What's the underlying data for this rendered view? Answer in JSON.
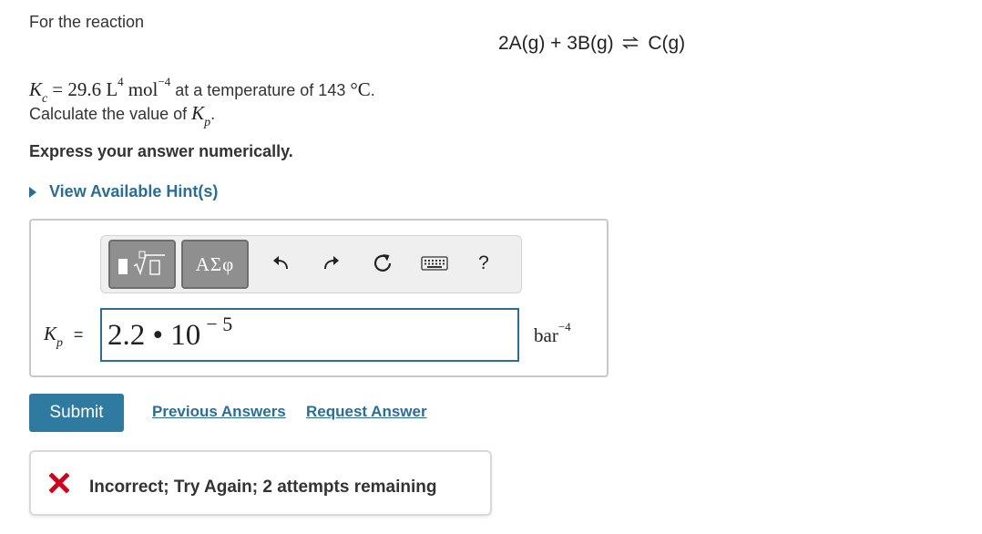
{
  "problem": {
    "intro": "For the reaction",
    "equation": {
      "left": "2A(g) + 3B(g)",
      "right": "C(g)"
    },
    "kc": {
      "symbol": "K",
      "subscript": "c",
      "value_text": "= 29.6 L",
      "l_exp": "4",
      "mol": "mol",
      "mol_exp": "−4",
      "temp_text": "at a temperature of 143",
      "temp_unit": "°C",
      "end": "."
    },
    "prompt_text": "Calculate the value of",
    "kp_symbol": "K",
    "kp_sub": "p",
    "prompt_end": ".",
    "instruction": "Express your answer numerically."
  },
  "hint": {
    "label": "View Available Hint(s)"
  },
  "toolbar": {
    "greek_label": "ΑΣφ",
    "help_label": "?",
    "icons": [
      "templates-icon",
      "greek-symbols-icon",
      "undo-icon",
      "redo-icon",
      "reset-icon",
      "keyboard-icon",
      "help-icon"
    ]
  },
  "answer": {
    "label_symbol": "K",
    "label_sub": "p",
    "label_eq": "=",
    "mantissa": "2.2 • 10",
    "exponent": "− 5",
    "unit": "bar",
    "unit_exp": "−4"
  },
  "actions": {
    "submit": "Submit",
    "previous": "Previous Answers",
    "request": "Request Answer"
  },
  "feedback": {
    "message": "Incorrect; Try Again; 2 attempts remaining"
  },
  "colors": {
    "link": "#2a6e96",
    "submit_bg": "#2f7aa1",
    "error": "#d0021b",
    "input_border": "#2a6e96"
  }
}
